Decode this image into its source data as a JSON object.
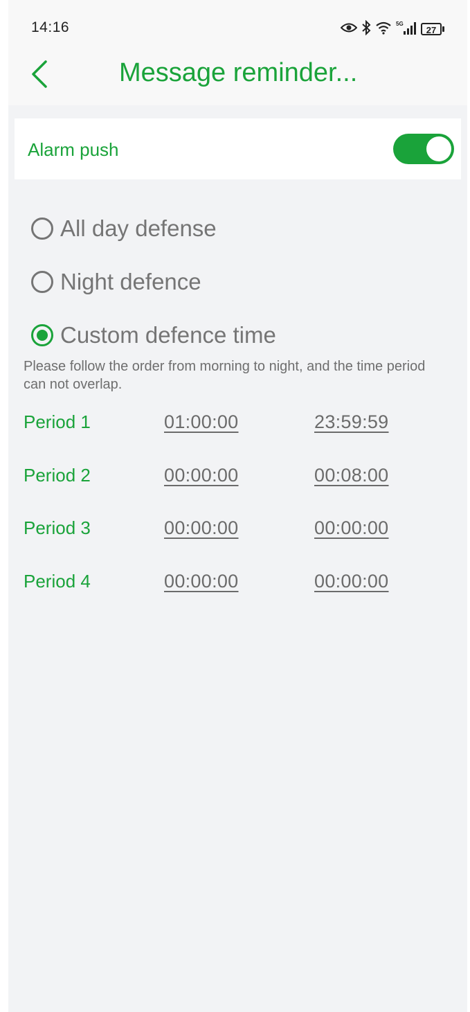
{
  "status_bar": {
    "time": "14:16",
    "battery": "27",
    "icons": [
      "eye-icon",
      "bluetooth-icon",
      "wifi-icon",
      "signal-icon",
      "battery-icon"
    ]
  },
  "header": {
    "title": "Message reminder..."
  },
  "alarm_push": {
    "label": "Alarm push",
    "enabled": true
  },
  "defense_modes": [
    {
      "label": "All day defense",
      "selected": false
    },
    {
      "label": "Night defence",
      "selected": false
    },
    {
      "label": "Custom defence time",
      "selected": true
    }
  ],
  "hint": "Please follow the order from morning to night, and the time period can not overlap.",
  "periods": [
    {
      "label": "Period 1",
      "start": "01:00:00",
      "end": "23:59:59"
    },
    {
      "label": "Period 2",
      "start": "00:00:00",
      "end": "00:08:00"
    },
    {
      "label": "Period 3",
      "start": "00:00:00",
      "end": "00:00:00"
    },
    {
      "label": "Period 4",
      "start": "00:00:00",
      "end": "00:00:00"
    }
  ],
  "colors": {
    "accent": "#1aa33a",
    "background": "#f2f3f5",
    "muted_text": "#757575"
  }
}
